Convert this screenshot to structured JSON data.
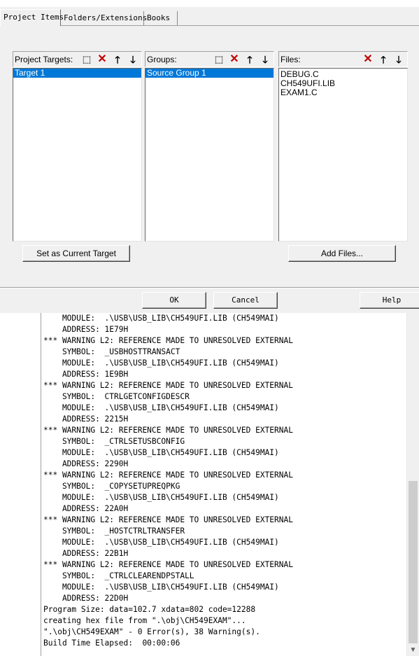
{
  "dialog": {
    "tabs": [
      {
        "label": "Project Items"
      },
      {
        "label": "Folders/Extensions"
      },
      {
        "label": "Books"
      }
    ],
    "targets": {
      "label": "Project Targets:",
      "items": [
        "Target 1"
      ]
    },
    "groups": {
      "label": "Groups:",
      "items": [
        "Source Group 1"
      ]
    },
    "files": {
      "label": "Files:",
      "items": [
        "DEBUG.C",
        "CH549UFI.LIB",
        "EXAM1.C"
      ]
    },
    "set_current_target_label": "Set as Current Target",
    "add_files_label": "Add Files...",
    "ok_label": "OK",
    "cancel_label": "Cancel",
    "help_label": "Help"
  },
  "output": {
    "lines": [
      "    MODULE:  .\\USB\\USB_LIB\\CH549UFI.LIB (CH549MAI)",
      "    ADDRESS: 1E79H",
      "*** WARNING L2: REFERENCE MADE TO UNRESOLVED EXTERNAL",
      "    SYMBOL:  _USBHOSTTRANSACT",
      "    MODULE:  .\\USB\\USB_LIB\\CH549UFI.LIB (CH549MAI)",
      "    ADDRESS: 1E9BH",
      "*** WARNING L2: REFERENCE MADE TO UNRESOLVED EXTERNAL",
      "    SYMBOL:  CTRLGETCONFIGDESCR",
      "    MODULE:  .\\USB\\USB_LIB\\CH549UFI.LIB (CH549MAI)",
      "    ADDRESS: 2215H",
      "*** WARNING L2: REFERENCE MADE TO UNRESOLVED EXTERNAL",
      "    SYMBOL:  _CTRLSETUSBCONFIG",
      "    MODULE:  .\\USB\\USB_LIB\\CH549UFI.LIB (CH549MAI)",
      "    ADDRESS: 2290H",
      "*** WARNING L2: REFERENCE MADE TO UNRESOLVED EXTERNAL",
      "    SYMBOL:  _COPYSETUPREQPKG",
      "    MODULE:  .\\USB\\USB_LIB\\CH549UFI.LIB (CH549MAI)",
      "    ADDRESS: 22A0H",
      "*** WARNING L2: REFERENCE MADE TO UNRESOLVED EXTERNAL",
      "    SYMBOL:  _HOSTCTRLTRANSFER",
      "    MODULE:  .\\USB\\USB_LIB\\CH549UFI.LIB (CH549MAI)",
      "    ADDRESS: 22B1H",
      "*** WARNING L2: REFERENCE MADE TO UNRESOLVED EXTERNAL",
      "    SYMBOL:  _CTRLCLEARENDPSTALL",
      "    MODULE:  .\\USB\\USB_LIB\\CH549UFI.LIB (CH549MAI)",
      "    ADDRESS: 22D0H",
      "Program Size: data=102.7 xdata=802 code=12288",
      "creating hex file from \".\\obj\\CH549EXAM\"...",
      "\".\\obj\\CH549EXAM\" - 0 Error(s), 38 Warning(s).",
      "Build Time Elapsed:  00:00:06"
    ]
  },
  "icons": {
    "new": "new-item-icon",
    "delete": "delete-icon",
    "up": "move-up-icon",
    "down": "move-down-icon",
    "scroll_up": "scroll-up-arrow-icon",
    "scroll_down": "scroll-down-arrow-icon"
  },
  "colors": {
    "selection": "#0078d7",
    "delete_icon": "#c00000",
    "dialog_bg": "#f0f0f0"
  }
}
